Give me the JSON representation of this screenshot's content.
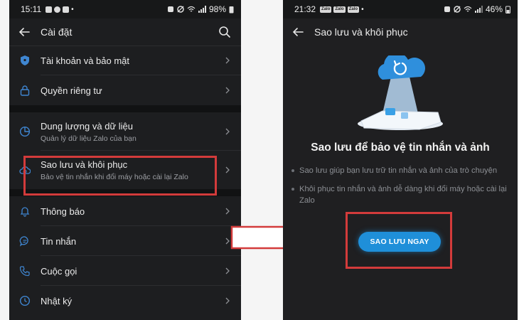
{
  "left": {
    "status": {
      "time": "15:11",
      "battery": "98%"
    },
    "appbar": {
      "title": "Cài đặt"
    },
    "items": [
      {
        "icon": "shield-icon",
        "title": "Tài khoản và bảo mật"
      },
      {
        "icon": "lock-icon",
        "title": "Quyền riêng tư"
      },
      {
        "icon": "pie-chart-icon",
        "title": "Dung lượng và dữ liệu",
        "subtitle": "Quản lý dữ liệu Zalo của bạn"
      },
      {
        "icon": "cloud-restore-icon",
        "title": "Sao lưu và khôi phục",
        "subtitle": "Bảo vệ tin nhắn khi đổi máy hoặc cài lại Zalo"
      },
      {
        "icon": "bell-icon",
        "title": "Thông báo"
      },
      {
        "icon": "chat-bubble-icon",
        "title": "Tin nhắn"
      },
      {
        "icon": "phone-icon",
        "title": "Cuộc gọi"
      },
      {
        "icon": "clock-icon",
        "title": "Nhật ký"
      }
    ]
  },
  "right": {
    "status": {
      "time": "21:32",
      "battery": "46%",
      "app_badges": [
        "Zalo",
        "Zalo",
        "Zalo"
      ]
    },
    "appbar": {
      "title": "Sao lưu và khôi phục"
    },
    "headline": "Sao lưu để bảo vệ tin nhắn và ảnh",
    "bullets": [
      "Sao lưu giúp bạn lưu trữ tin nhắn và ảnh của trò chuyện",
      "Khôi phục tin nhắn và ảnh dễ dàng khi đổi máy hoặc cài lại Zalo"
    ],
    "cta_label": "SAO LƯU NGAY"
  },
  "colors": {
    "accent": "#1f8fd9",
    "highlight": "#d33b3b",
    "dark_bg": "#1d1e20"
  }
}
